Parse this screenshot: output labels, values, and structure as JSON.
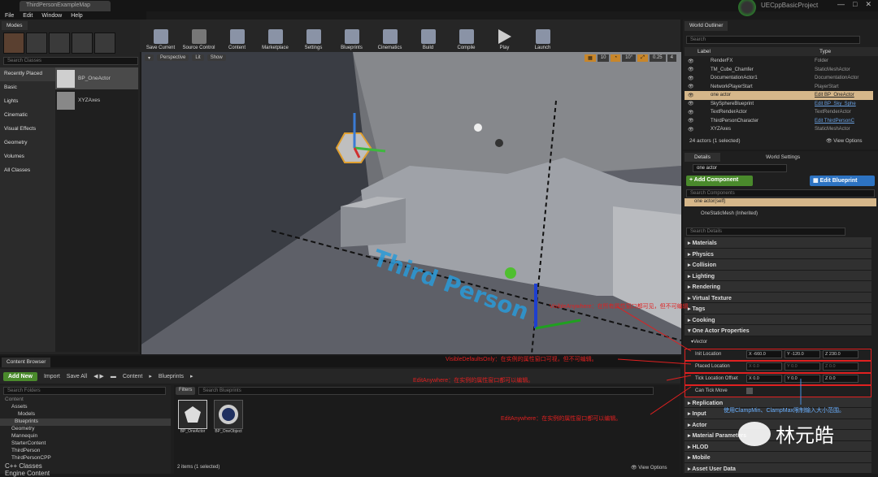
{
  "window": {
    "tab_title": "ThirdPersonExampleMap",
    "project_name": "UECppBasicProject",
    "menu": [
      "File",
      "Edit",
      "Window",
      "Help"
    ]
  },
  "modes": {
    "tab": "Modes",
    "search_placeholder": "Search Classes",
    "categories": [
      "Recently Placed",
      "Basic",
      "Lights",
      "Cinematic",
      "Visual Effects",
      "Geometry",
      "Volumes",
      "All Classes"
    ],
    "placed_items": [
      "BP_OneActor",
      "XYZAxes"
    ]
  },
  "toolbar": {
    "buttons": [
      "Save Current",
      "Source Control",
      "Content",
      "Marketplace",
      "Settings",
      "Blueprints",
      "Cinematics",
      "Build",
      "Compile",
      "Play",
      "Launch"
    ]
  },
  "viewport": {
    "buttons": [
      "Perspective",
      "Lit",
      "Show"
    ],
    "grid": "10",
    "rotate": "10°",
    "scale": "0.25",
    "cam": "4",
    "overlay_text": "Third Person"
  },
  "content_browser": {
    "tab": "Content Browser",
    "add_new": "Add New",
    "import": "Import",
    "save_all": "Save All",
    "path": [
      "Content",
      "Blueprints"
    ],
    "search_folders": "Search Folders",
    "filters": "Filters",
    "search_assets": "Search Blueprints",
    "tree": [
      "Content",
      "Assets",
      "Models",
      "Blueprints",
      "Geometry",
      "Mannequin",
      "StarterContent",
      "ThirdPerson",
      "ThirdPersonCPP",
      "C++ Classes",
      "Engine Content"
    ],
    "assets": [
      "BP_OneActor",
      "BP_OneObject"
    ],
    "status": "2 items (1 selected)",
    "view_options": "View Options"
  },
  "world_outliner": {
    "tab": "World Outliner",
    "search_placeholder": "Search",
    "columns": [
      "Label",
      "Type"
    ],
    "rows": [
      {
        "label": "RenderFX",
        "type": "Folder"
      },
      {
        "label": "TM_Cube_Chamfer",
        "type": "StaticMeshActor"
      },
      {
        "label": "DocumentationActor1",
        "type": "DocumentationActor"
      },
      {
        "label": "NetworkPlayerStart",
        "type": "PlayerStart"
      },
      {
        "label": "one actor",
        "type": "Edit BP_OneActor"
      },
      {
        "label": "SkySphereBlueprint",
        "type": "Edit BP_Sky_Sphe"
      },
      {
        "label": "TextRenderActor",
        "type": "TextRenderActor"
      },
      {
        "label": "ThirdPersonCharacter",
        "type": "Edit ThirdPersonC"
      },
      {
        "label": "XYZAxes",
        "type": "StaticMeshActor"
      }
    ],
    "status": "24 actors (1 selected)",
    "view_options": "View Options"
  },
  "details": {
    "tab": "Details",
    "tab2": "World Settings",
    "name": "one actor",
    "add_component": "+ Add Component",
    "edit_blueprint": "Edit Blueprint",
    "search_components": "Search Components",
    "self_item": "one actor(self)",
    "mesh_item": "OneStaticMesh (Inherited)",
    "search_details": "Search Details",
    "sections_top": [
      "Materials",
      "Physics",
      "Collision",
      "Lighting",
      "Rendering",
      "Virtual Texture",
      "Tags",
      "Cooking",
      "One Actor Properties"
    ],
    "vector_label": "Vector",
    "props": [
      {
        "name": "Init Location",
        "x": "X -660.0",
        "y": "Y -120.0",
        "z": "Z 230.0"
      },
      {
        "name": "Placed Location",
        "x": "X 0.0",
        "y": "Y 0.0",
        "z": "Z 0.0"
      },
      {
        "name": "Tick Location Offset",
        "x": "X 0.0",
        "y": "Y 0.0",
        "z": "Z 0.0"
      }
    ],
    "can_tick_move": "Can Tick Move",
    "sections_bottom": [
      "Replication",
      "Input",
      "Actor",
      "Material Parameters",
      "HLOD",
      "Mobile",
      "Asset User Data"
    ]
  },
  "annotations": {
    "a1": "VisibleDefaultsOnly：在实例的属性窗口可视，但不可编辑。",
    "a2": "EditAnywhere：在实例的属性窗口都可以编辑。",
    "a3": "EditAnywhere：在实例的属性窗口都可以编辑。",
    "a4": "VisibleAnywhere：在所有属性窗口都可见，但不可编辑",
    "a5": "使用ClampMin、ClampMax限制输入大小范围。"
  },
  "watermark": {
    "text": "林元皓"
  },
  "colors": {
    "accent": "#c8862a",
    "add_green": "#4a8a2c",
    "edit_blue": "#2d73c2",
    "red": "#e02020"
  }
}
